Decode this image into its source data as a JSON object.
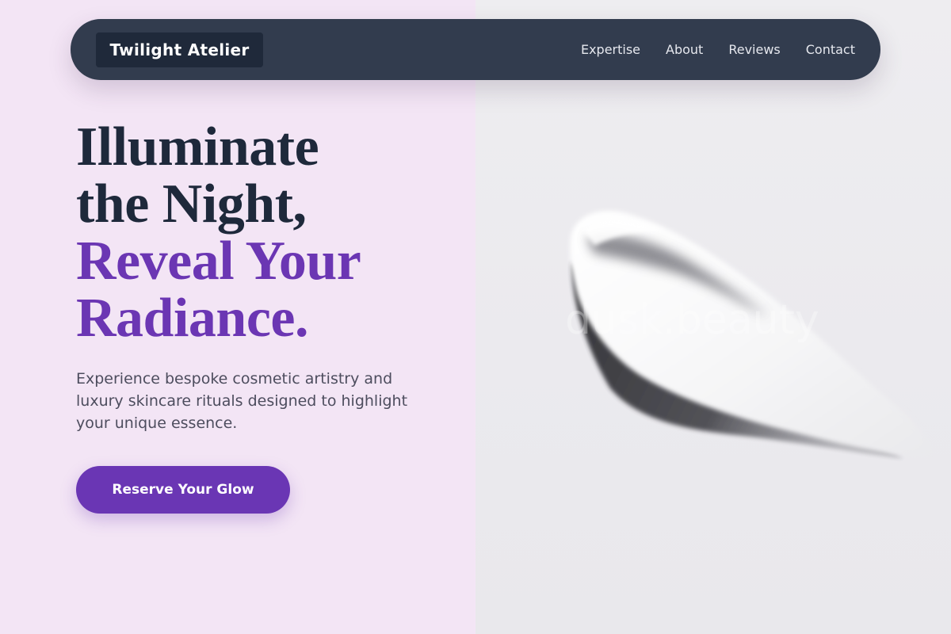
{
  "nav": {
    "brand": "Twilight Atelier",
    "links": [
      "Expertise",
      "About",
      "Reviews",
      "Contact"
    ]
  },
  "hero": {
    "title_lines": [
      "Illuminate",
      "the Night,"
    ],
    "accent_lines": [
      "Reveal Your",
      "Radiance."
    ],
    "subtitle": "Experience bespoke cosmetic artistry and luxury skincare rituals designed to highlight your unique essence.",
    "cta_label": "Reserve Your Glow"
  },
  "image": {
    "watermark": "dusk.beauty"
  },
  "colors": {
    "left_background": "#f3e5f5",
    "nav_background": "#323c4e",
    "brand_background": "#1f293a",
    "heading_dark": "#1e293b",
    "accent_purple": "#6a36b4",
    "body_text": "#4d4d5e"
  }
}
